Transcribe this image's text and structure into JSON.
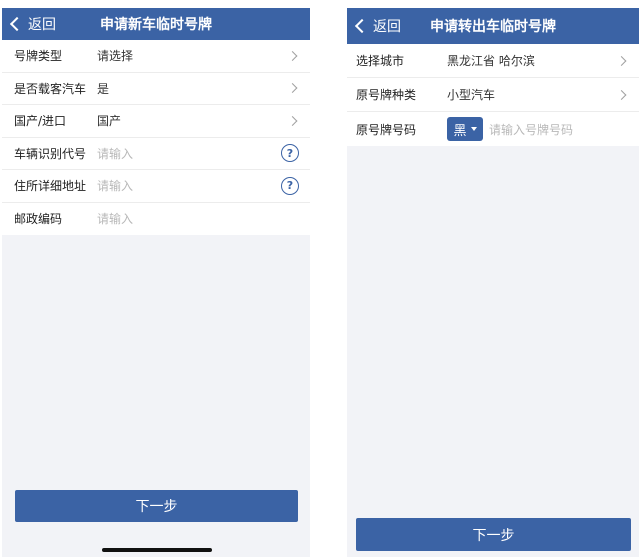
{
  "left": {
    "back_label": "返回",
    "title": "申请新车临时号牌",
    "rows": [
      {
        "label": "号牌类型",
        "value": "请选择",
        "placeholder": ""
      },
      {
        "label": "是否载客汽车",
        "value": "是",
        "placeholder": ""
      },
      {
        "label": "国产/进口",
        "value": "国产",
        "placeholder": ""
      },
      {
        "label": "车辆识别代号",
        "value": "",
        "placeholder": "请输入"
      },
      {
        "label": "住所详细地址",
        "value": "",
        "placeholder": "请输入"
      },
      {
        "label": "邮政编码",
        "value": "",
        "placeholder": "请输入"
      }
    ],
    "help_glyph": "?",
    "next_label": "下一步"
  },
  "right": {
    "back_label": "返回",
    "title": "申请转出车临时号牌",
    "rows": [
      {
        "label": "选择城市",
        "value": "黑龙江省 哈尔滨"
      },
      {
        "label": "原号牌种类",
        "value": "小型汽车"
      },
      {
        "label": "原号牌号码",
        "prefix": "黑",
        "placeholder": "请输入号牌号码"
      }
    ],
    "next_label": "下一步"
  },
  "icons": {
    "back": "chevron-left-icon",
    "arrow": "chevron-right-icon",
    "help": "question-circle-icon",
    "prefix_dropdown": "caret-down-icon"
  },
  "colors": {
    "primary": "#3b63a5",
    "background": "#f2f3f7",
    "placeholder": "#b8b8b8"
  }
}
